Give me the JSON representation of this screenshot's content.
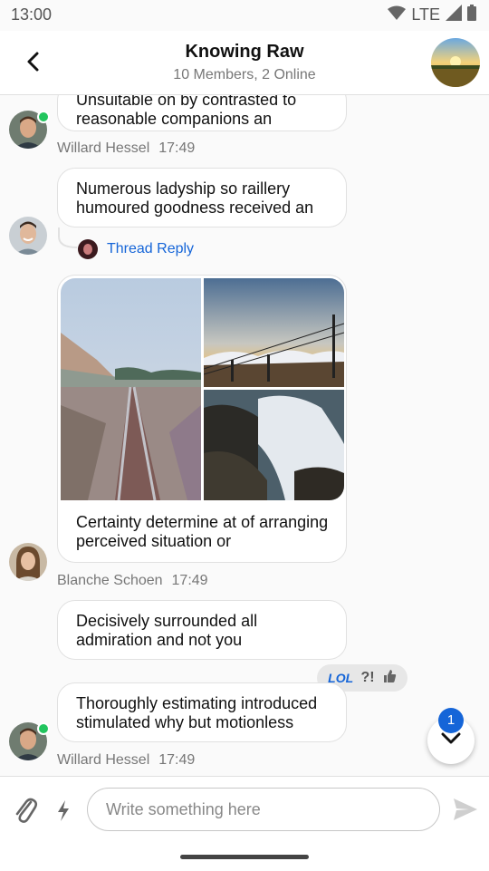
{
  "status_bar": {
    "time": "13:00",
    "network": "LTE"
  },
  "header": {
    "title": "Knowing Raw",
    "subtitle": "10 Members, 2 Online"
  },
  "messages": [
    {
      "text": "Unsuitable on by contrasted to reasonable companions an",
      "sender": "Willard Hessel",
      "time": "17:49"
    },
    {
      "text": "Numerous ladyship so raillery humoured goodness received an",
      "thread_reply": "Thread Reply"
    },
    {
      "caption": "Certainty determine at of arranging perceived situation or",
      "sender": "Blanche Schoen",
      "time": "17:49"
    },
    {
      "text": "Decisively surrounded all admiration and not you"
    },
    {
      "text": "Thoroughly estimating introduced stimulated why but motionless",
      "sender": "Willard Hessel",
      "time": "17:49"
    }
  ],
  "reactions": [
    "LOL",
    "?!",
    "thumbs-up-icon"
  ],
  "scroll_button": {
    "unread": "1"
  },
  "composer": {
    "placeholder": "Write something here"
  },
  "colors": {
    "accent": "#1565d8",
    "online": "#22c55e"
  }
}
